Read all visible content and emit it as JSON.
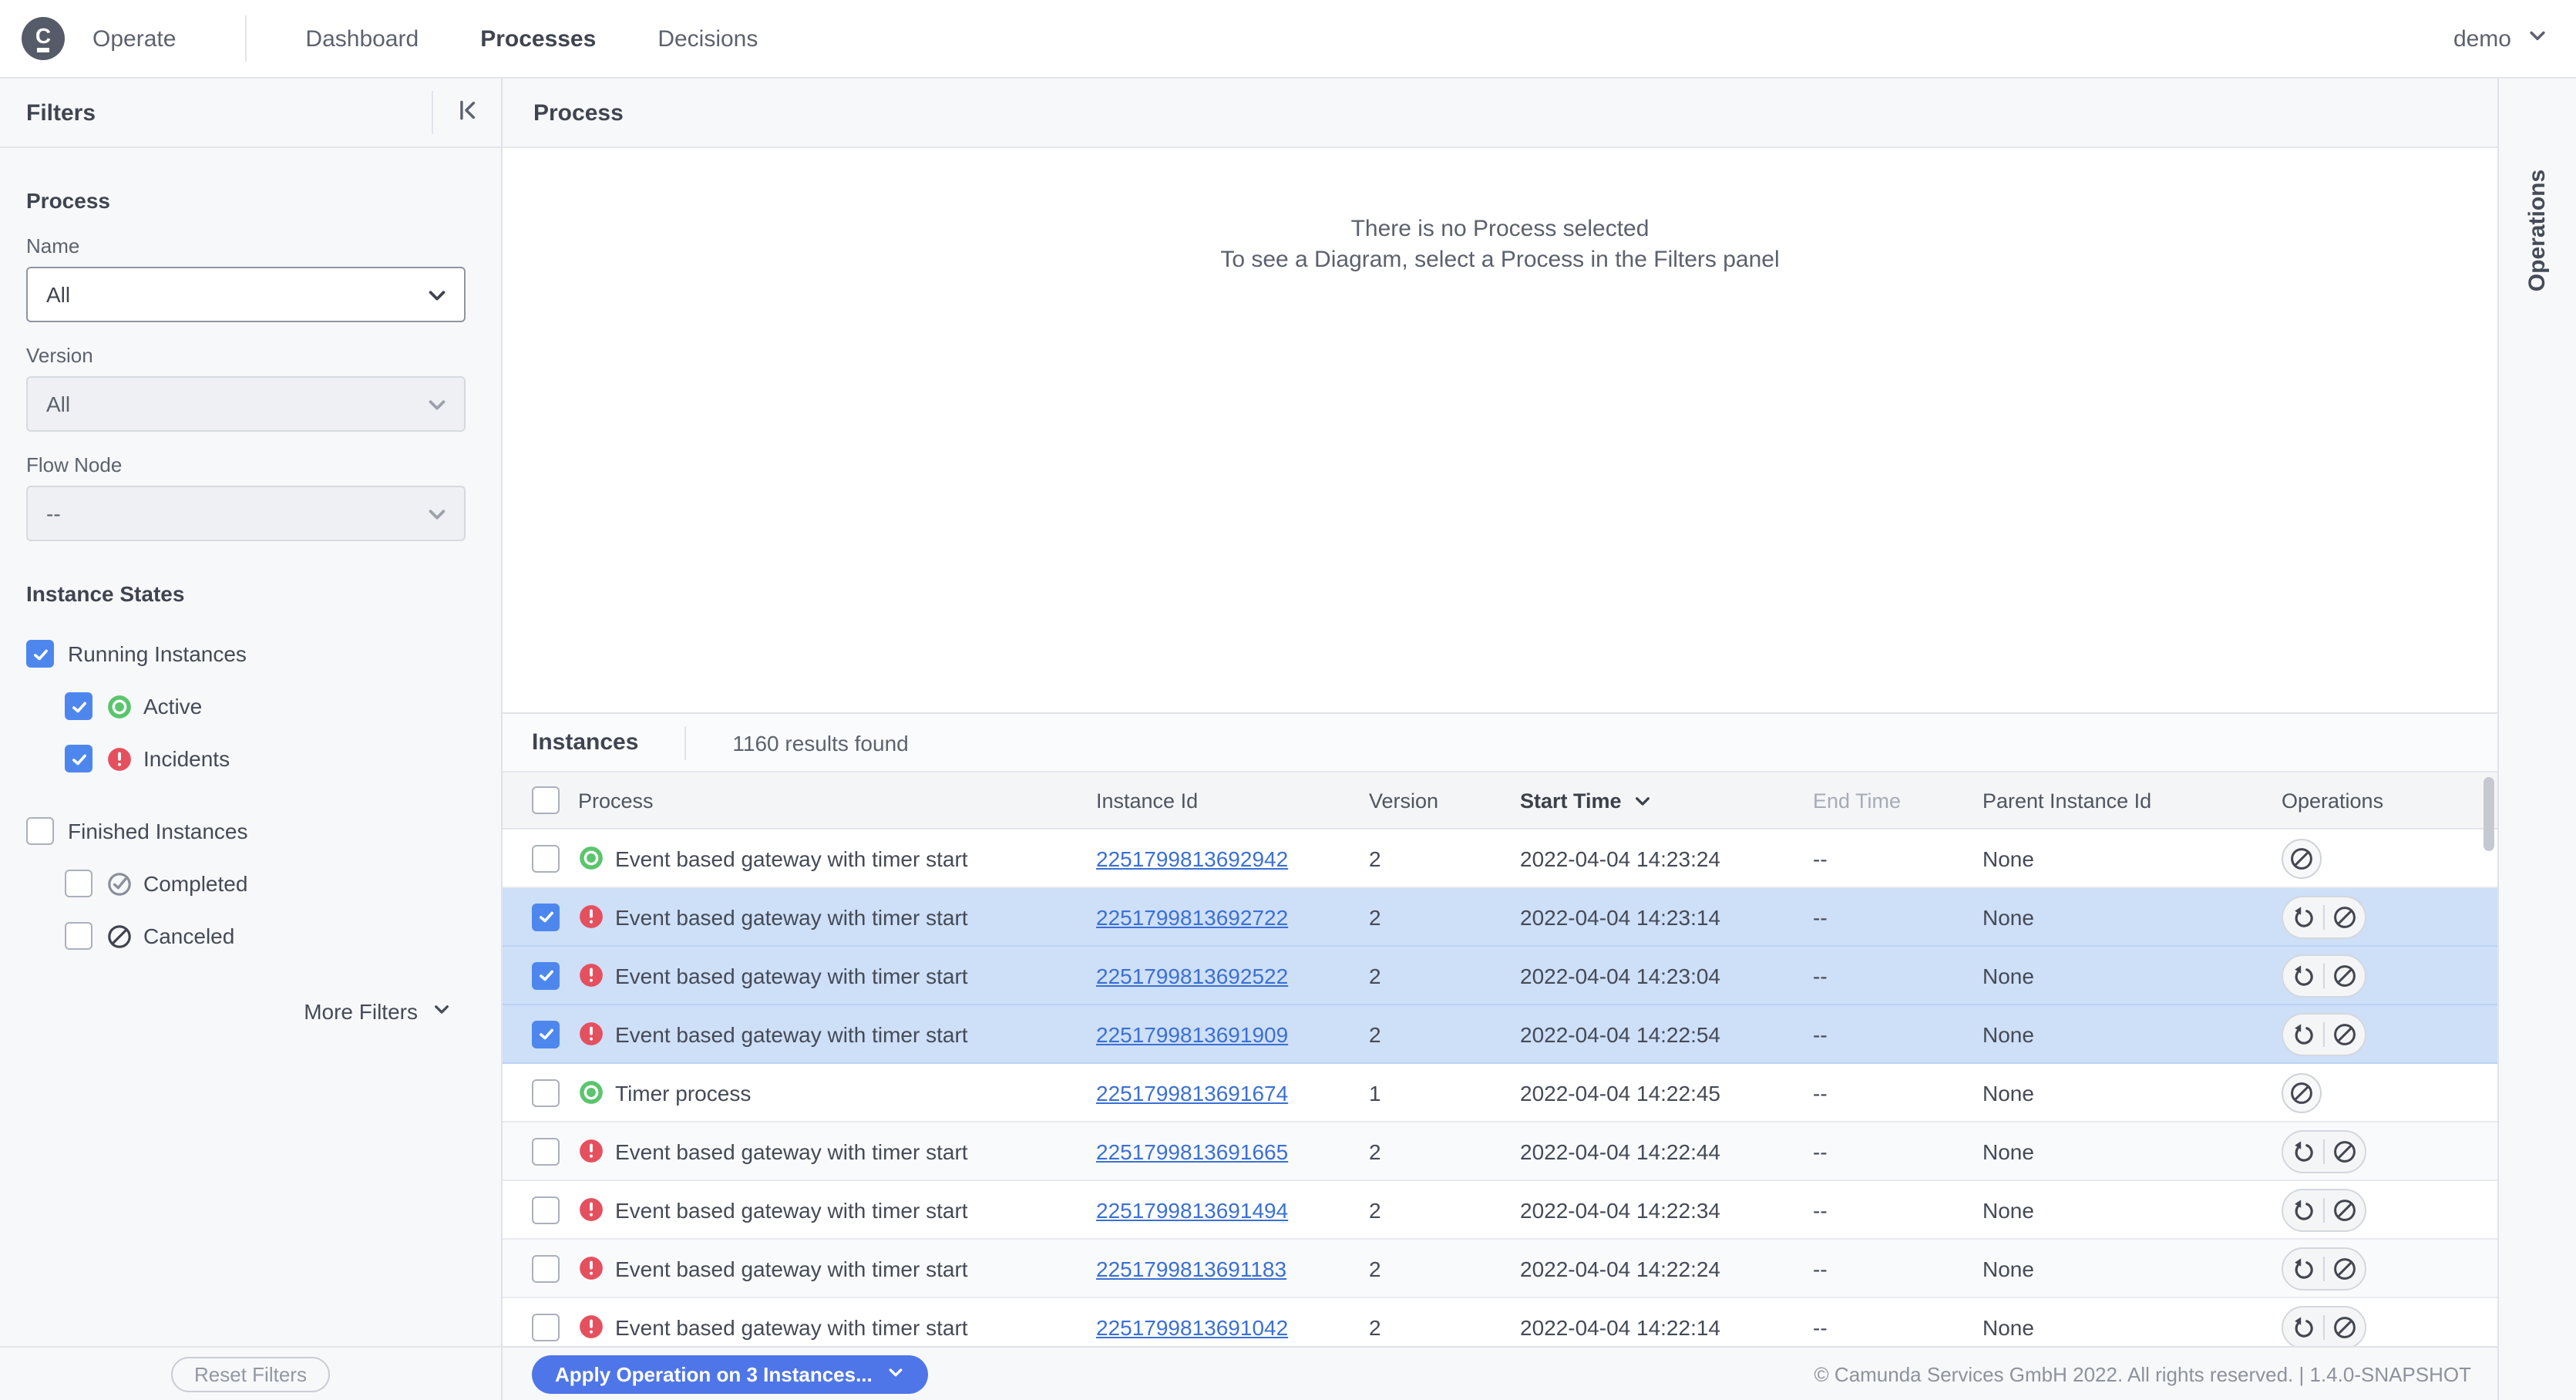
{
  "topbar": {
    "brand": "Operate",
    "nav": [
      {
        "label": "Dashboard",
        "active": false
      },
      {
        "label": "Processes",
        "active": true
      },
      {
        "label": "Decisions",
        "active": false
      }
    ],
    "user": "demo"
  },
  "filters": {
    "title": "Filters",
    "section_process": {
      "title": "Process",
      "fields": [
        {
          "key": "name",
          "label": "Name",
          "value": "All",
          "disabled": false
        },
        {
          "key": "version",
          "label": "Version",
          "value": "All",
          "disabled": true
        },
        {
          "key": "flow-node",
          "label": "Flow Node",
          "value": "--",
          "disabled": true
        }
      ]
    },
    "section_states": {
      "title": "Instance States",
      "items": [
        {
          "key": "running-instances",
          "label": "Running Instances",
          "checked": true,
          "icon": null,
          "level": 0,
          "gap_before": false
        },
        {
          "key": "active",
          "label": "Active",
          "checked": true,
          "icon": "active",
          "level": 1,
          "gap_before": false
        },
        {
          "key": "incidents",
          "label": "Incidents",
          "checked": true,
          "icon": "incident",
          "level": 1,
          "gap_before": false
        },
        {
          "key": "finished-instances",
          "label": "Finished Instances",
          "checked": false,
          "icon": null,
          "level": 0,
          "gap_before": true
        },
        {
          "key": "completed",
          "label": "Completed",
          "checked": false,
          "icon": "completed",
          "level": 1,
          "gap_before": false
        },
        {
          "key": "canceled",
          "label": "Canceled",
          "checked": false,
          "icon": "canceled",
          "level": 1,
          "gap_before": false
        }
      ]
    },
    "more_filters": "More Filters",
    "reset_button": "Reset Filters"
  },
  "process_panel": {
    "title": "Process",
    "empty_line1": "There is no Process selected",
    "empty_line2": "To see a Diagram, select a Process in the Filters panel"
  },
  "instances_panel": {
    "title": "Instances",
    "results_count": "1160 results found",
    "columns": [
      "Process",
      "Instance Id",
      "Version",
      "Start Time",
      "End Time",
      "Parent Instance Id",
      "Operations"
    ],
    "sort": {
      "column": "Start Time",
      "direction": "desc"
    },
    "rows": [
      {
        "state": "active",
        "selected": false,
        "process": "Event based gateway with timer start",
        "instance_id": "2251799813692942",
        "version": "2",
        "start_time": "2022-04-04 14:23:24",
        "end_time": "--",
        "parent_id": "None",
        "operations": [
          "cancel"
        ]
      },
      {
        "state": "incident",
        "selected": true,
        "process": "Event based gateway with timer start",
        "instance_id": "2251799813692722",
        "version": "2",
        "start_time": "2022-04-04 14:23:14",
        "end_time": "--",
        "parent_id": "None",
        "operations": [
          "retry",
          "cancel"
        ]
      },
      {
        "state": "incident",
        "selected": true,
        "process": "Event based gateway with timer start",
        "instance_id": "2251799813692522",
        "version": "2",
        "start_time": "2022-04-04 14:23:04",
        "end_time": "--",
        "parent_id": "None",
        "operations": [
          "retry",
          "cancel"
        ]
      },
      {
        "state": "incident",
        "selected": true,
        "process": "Event based gateway with timer start",
        "instance_id": "2251799813691909",
        "version": "2",
        "start_time": "2022-04-04 14:22:54",
        "end_time": "--",
        "parent_id": "None",
        "operations": [
          "retry",
          "cancel"
        ]
      },
      {
        "state": "active",
        "selected": false,
        "process": "Timer process",
        "instance_id": "2251799813691674",
        "version": "1",
        "start_time": "2022-04-04 14:22:45",
        "end_time": "--",
        "parent_id": "None",
        "operations": [
          "cancel"
        ]
      },
      {
        "state": "incident",
        "selected": false,
        "process": "Event based gateway with timer start",
        "instance_id": "2251799813691665",
        "version": "2",
        "start_time": "2022-04-04 14:22:44",
        "end_time": "--",
        "parent_id": "None",
        "operations": [
          "retry",
          "cancel"
        ]
      },
      {
        "state": "incident",
        "selected": false,
        "process": "Event based gateway with timer start",
        "instance_id": "2251799813691494",
        "version": "2",
        "start_time": "2022-04-04 14:22:34",
        "end_time": "--",
        "parent_id": "None",
        "operations": [
          "retry",
          "cancel"
        ]
      },
      {
        "state": "incident",
        "selected": false,
        "process": "Event based gateway with timer start",
        "instance_id": "2251799813691183",
        "version": "2",
        "start_time": "2022-04-04 14:22:24",
        "end_time": "--",
        "parent_id": "None",
        "operations": [
          "retry",
          "cancel"
        ]
      },
      {
        "state": "incident",
        "selected": false,
        "process": "Event based gateway with timer start",
        "instance_id": "2251799813691042",
        "version": "2",
        "start_time": "2022-04-04 14:22:14",
        "end_time": "--",
        "parent_id": "None",
        "operations": [
          "retry",
          "cancel"
        ]
      }
    ]
  },
  "footer": {
    "apply_button": "Apply Operation on 3 Instances...",
    "copyright": "© Camunda Services GmbH 2022. All rights reserved. | 1.4.0-SNAPSHOT"
  },
  "operations_panel": {
    "title": "Operations"
  },
  "colors": {
    "accent_blue": "#4d87ee",
    "selection_blue": "#cedff8",
    "link_blue": "#3b70d4",
    "active_green": "#5bc56d",
    "incident_red": "#e5505f",
    "apply_button_blue": "#4f76e8"
  }
}
